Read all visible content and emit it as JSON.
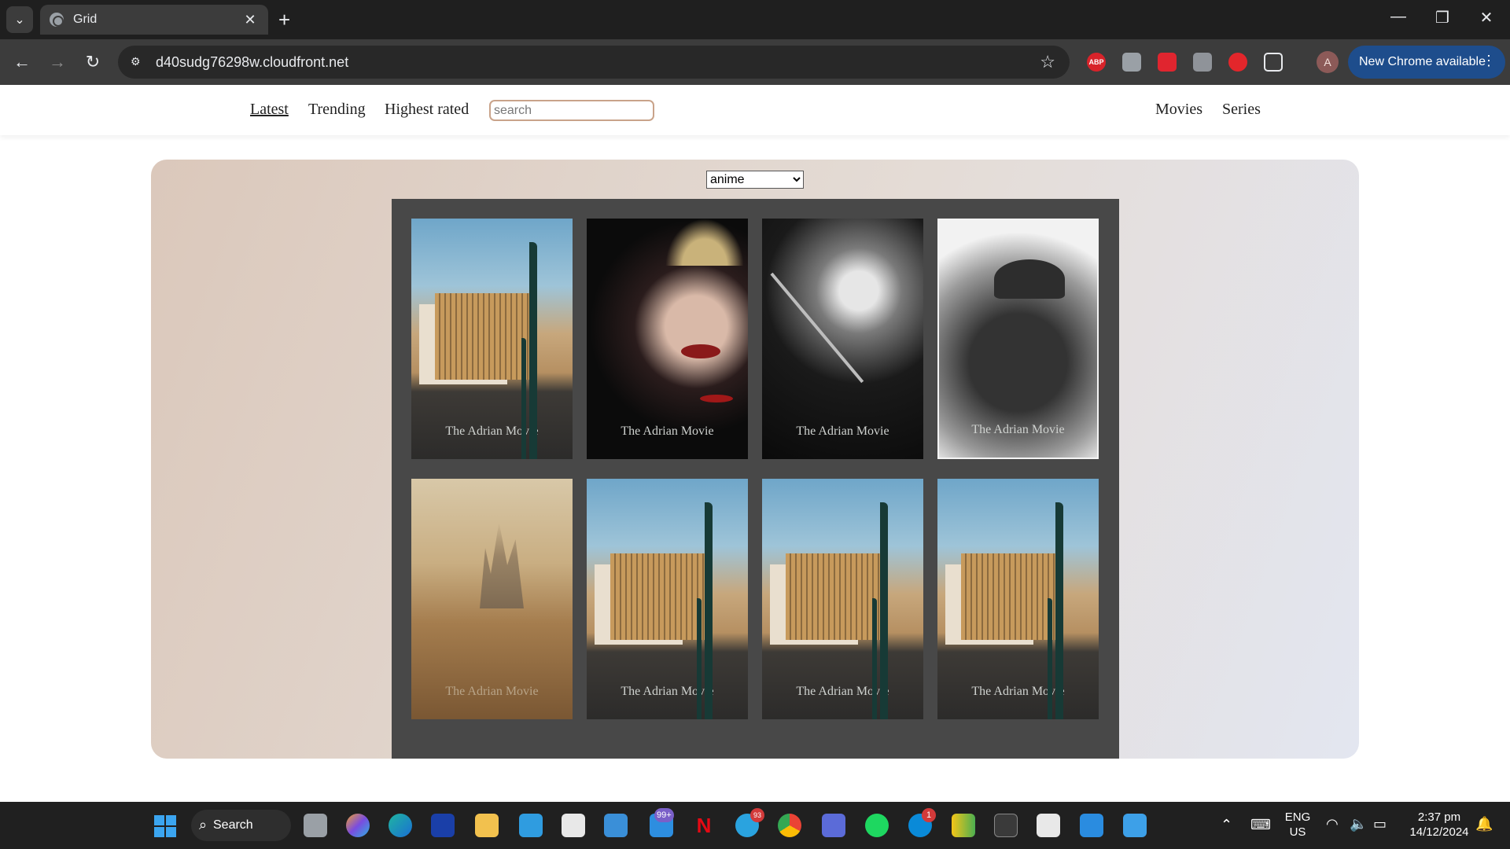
{
  "browser": {
    "tab_title": "Grid",
    "url": "d40sudg76298w.cloudfront.net",
    "update_label": "New Chrome available",
    "profile_initial": "A",
    "extension_abp": "ABP"
  },
  "site": {
    "nav": {
      "latest": "Latest",
      "trending": "Trending",
      "highest_rated": "Highest rated",
      "movies": "Movies",
      "series": "Series"
    },
    "search": {
      "placeholder": "search",
      "value": ""
    },
    "genre": {
      "selected": "anime",
      "options": [
        "anime"
      ]
    }
  },
  "movies": [
    {
      "title": "The Adrian Movie",
      "poster": "building"
    },
    {
      "title": "The Adrian Movie",
      "poster": "joker"
    },
    {
      "title": "The Adrian Movie",
      "poster": "woman"
    },
    {
      "title": "The Adrian Movie",
      "poster": "man"
    },
    {
      "title": "The Adrian Movie",
      "poster": "desert"
    },
    {
      "title": "The Adrian Movie",
      "poster": "building"
    },
    {
      "title": "The Adrian Movie",
      "poster": "building"
    },
    {
      "title": "The Adrian Movie",
      "poster": "building"
    }
  ],
  "taskbar": {
    "search_label": "Search",
    "mail_badge": "99+",
    "telegram_badge": "93",
    "skype_badge": "1",
    "language": "ENG",
    "region": "US",
    "time": "2:37 pm",
    "date": "14/12/2024"
  }
}
